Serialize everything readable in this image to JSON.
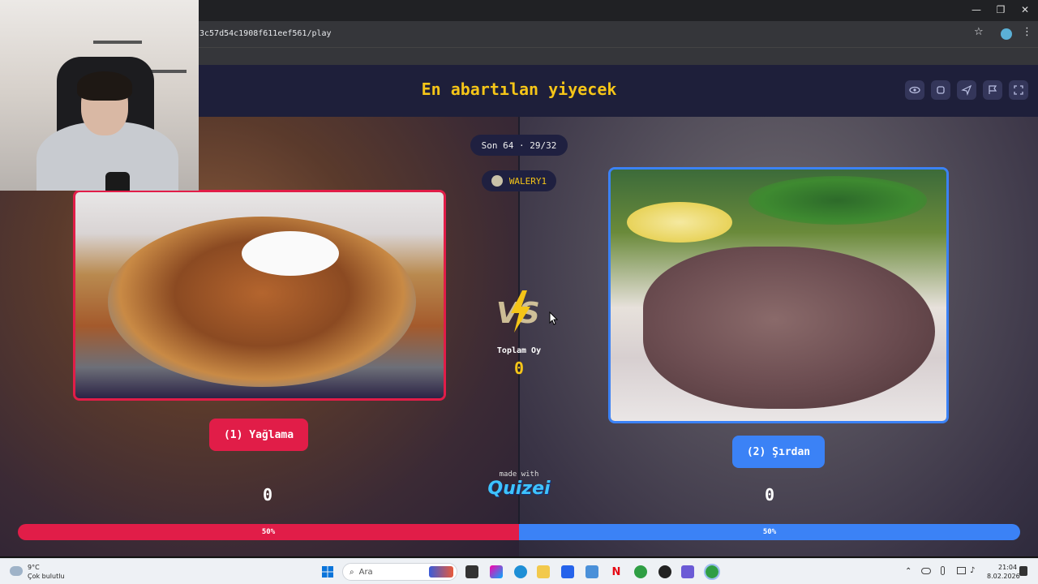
{
  "browser": {
    "url": "3c57d54c1908f611eef561/play",
    "star_icon": "☆",
    "minimize": "—",
    "restore": "❐",
    "close": "✕",
    "menu": "⋮"
  },
  "header": {
    "title": "En abartılan yiyecek"
  },
  "round": {
    "label": "Son 64 · 29/32",
    "player": "WALERY1"
  },
  "left": {
    "button_label": "(1) Yağlama",
    "votes": "0",
    "percent": "50%",
    "color": "#e11d48"
  },
  "right": {
    "button_label": "(2) Şırdan",
    "votes": "0",
    "percent": "50%",
    "color": "#3b82f6"
  },
  "center": {
    "total_label": "Toplam Oy",
    "total_value": "0",
    "made_with": "made with",
    "brand": "Quizei"
  },
  "progress": {
    "left_fraction": 0.5,
    "right_fraction": 0.5
  },
  "taskbar": {
    "weather_temp": "9°C",
    "weather_desc": "Çok bulutlu",
    "search_placeholder": "Ara",
    "time": "21:04",
    "date": "8.02.2026"
  }
}
